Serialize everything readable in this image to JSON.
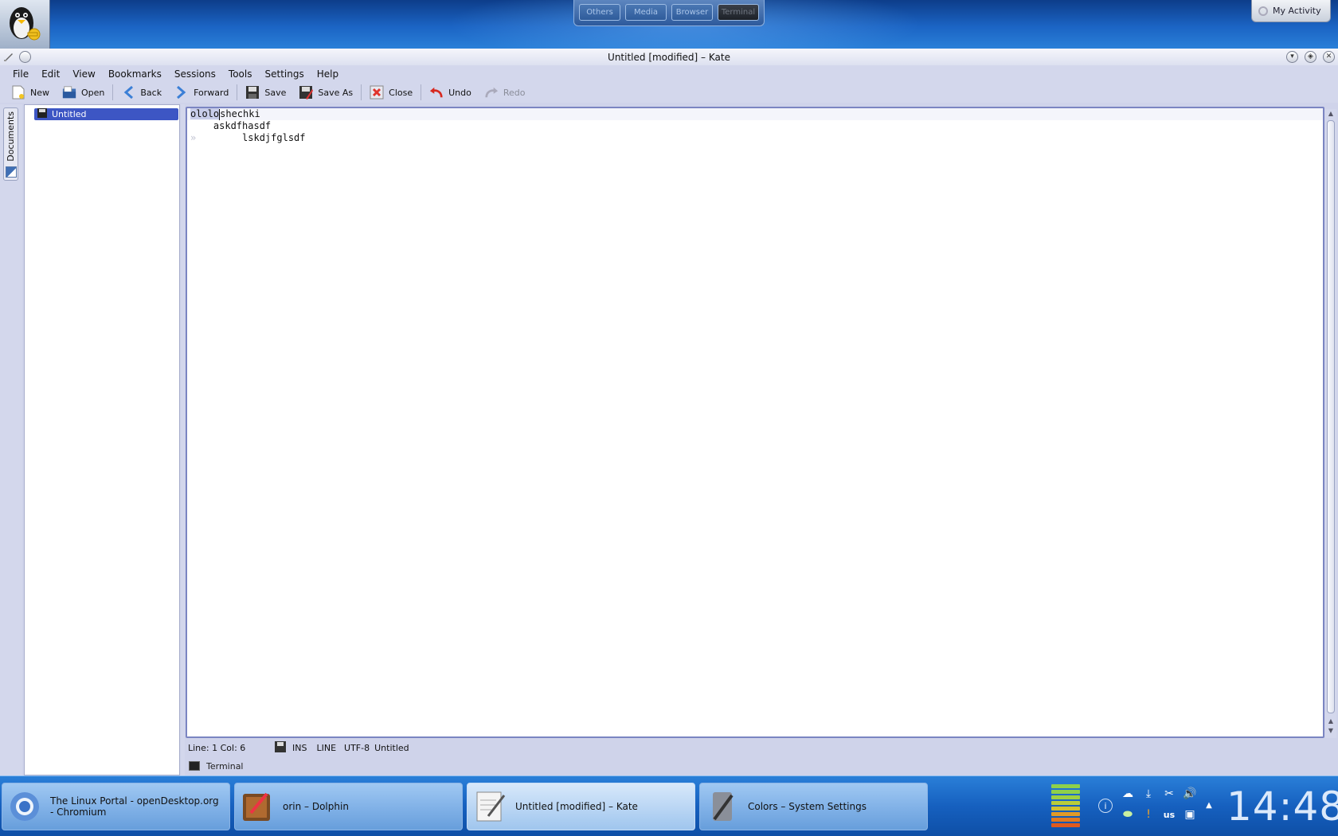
{
  "desktop": {
    "activities": [
      "Others",
      "Media",
      "Browser",
      "Terminal"
    ],
    "active_activity": "Terminal",
    "my_activity_label": "My Activity"
  },
  "window": {
    "title": "Untitled [modified] – Kate"
  },
  "menubar": {
    "items": [
      "File",
      "Edit",
      "View",
      "Bookmarks",
      "Sessions",
      "Tools",
      "Settings",
      "Help"
    ]
  },
  "toolbar": {
    "new": "New",
    "open": "Open",
    "back": "Back",
    "forward": "Forward",
    "save": "Save",
    "save_as": "Save As",
    "close": "Close",
    "undo": "Undo",
    "redo": "Redo"
  },
  "sidebar": {
    "tab_label": "Documents",
    "documents": [
      "Untitled"
    ]
  },
  "editor": {
    "lines": [
      {
        "selected": "ololo",
        "rest": "shechki"
      },
      {
        "text": "    askdfhasdf"
      },
      {
        "text": "        lskdjfglsdf"
      }
    ],
    "fold_marker": "»"
  },
  "statusbar": {
    "position": "Line: 1 Col: 6",
    "mode": "INS",
    "selection_mode": "LINE",
    "encoding": "UTF-8",
    "doc_name": "Untitled"
  },
  "bottom_tool": {
    "terminal": "Terminal"
  },
  "taskbar": {
    "tasks": [
      {
        "label": "The Linux Portal - openDesktop.org - Chromium",
        "icon": "chromium-icon"
      },
      {
        "label": "orin – Dolphin",
        "icon": "dolphin-icon"
      },
      {
        "label": "Untitled [modified] – Kate",
        "icon": "kate-icon"
      },
      {
        "label": "Colors – System Settings",
        "icon": "system-settings-icon"
      }
    ],
    "keyboard_layout": "us",
    "clock": "14:48"
  }
}
